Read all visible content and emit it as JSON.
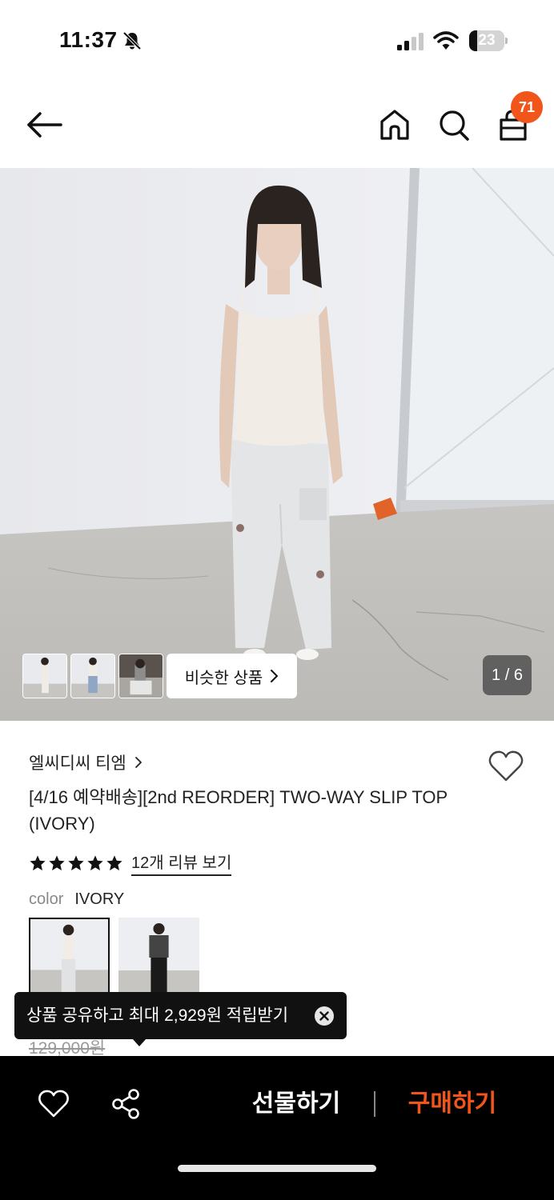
{
  "status_bar": {
    "time": "11:37",
    "battery": "23",
    "icons": [
      "bell-slash-icon",
      "signal-icon",
      "wifi-icon",
      "battery-icon"
    ]
  },
  "nav": {
    "icons": [
      "back-arrow-icon",
      "home-icon",
      "search-icon",
      "shopping-bag-icon"
    ],
    "cart_count": "71",
    "badge_color": "#f2551a"
  },
  "hero": {
    "similar_label": "비슷한 상품",
    "page_indicator": "1 / 6",
    "thumbnail_count": 3
  },
  "product": {
    "brand": "엘씨디씨 티엠",
    "title": "[4/16 예약배송][2nd REORDER] TWO-WAY SLIP TOP (IVORY)",
    "rating": 5,
    "review_link": "12개 리뷰 보기",
    "color_label": "color",
    "color_value": "IVORY",
    "original_price": "129,000원"
  },
  "toast": {
    "message": "상품 공유하고 최대 2,929원 적립받기"
  },
  "bottom_bar": {
    "gift_label": "선물하기",
    "buy_label": "구매하기",
    "accent": "#f2551a",
    "icons": [
      "heart-icon",
      "share-icon"
    ]
  }
}
